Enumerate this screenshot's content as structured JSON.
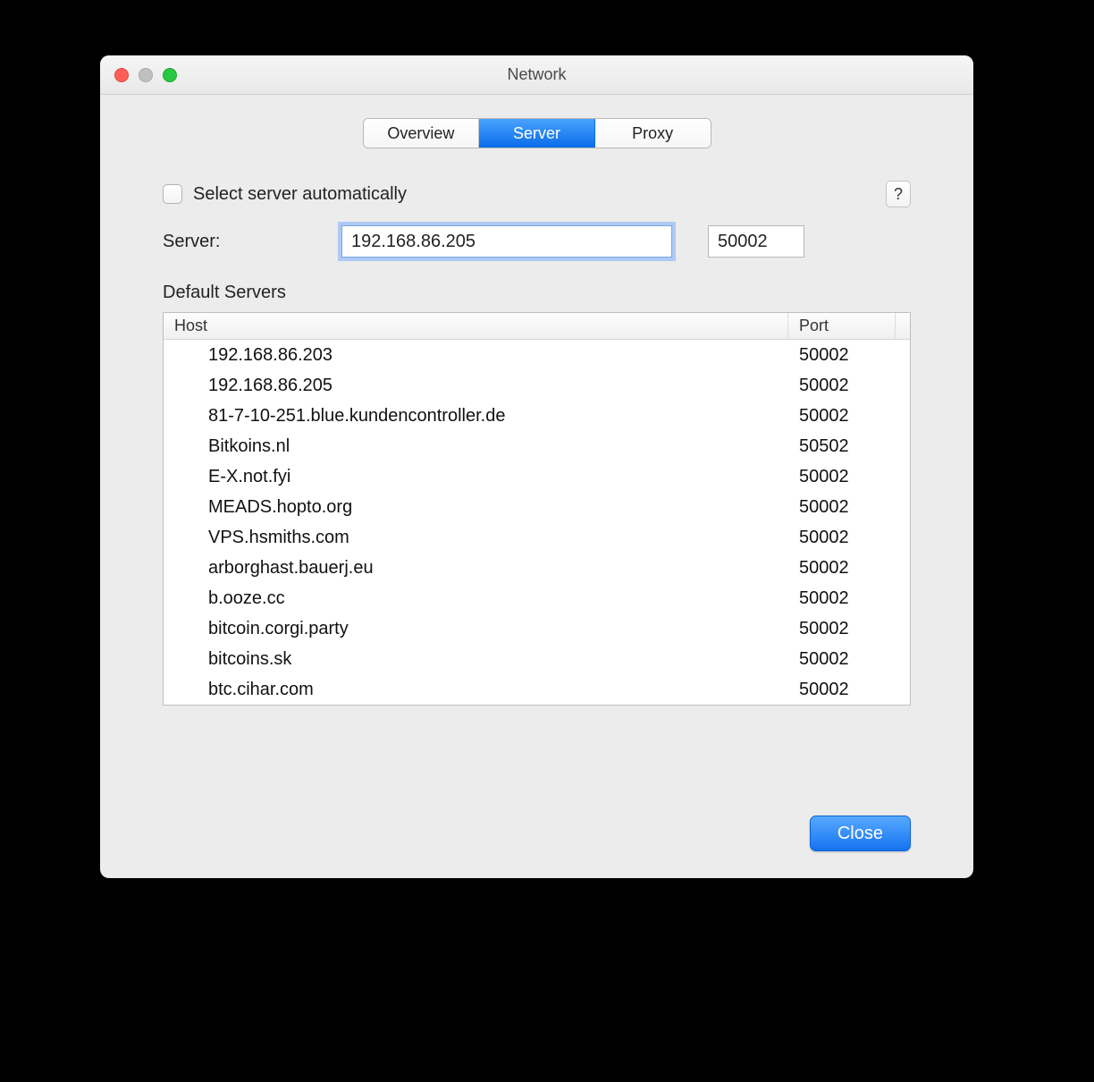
{
  "window": {
    "title": "Network"
  },
  "tabs": {
    "overview": "Overview",
    "server": "Server",
    "proxy": "Proxy",
    "active": "server"
  },
  "auto_select": {
    "checked": false,
    "label": "Select server automatically"
  },
  "help": {
    "label": "?"
  },
  "server_field": {
    "label": "Server:",
    "value": "192.168.86.205",
    "port": "50002"
  },
  "default_servers": {
    "label": "Default Servers",
    "columns": {
      "host": "Host",
      "port": "Port"
    },
    "rows": [
      {
        "host": "192.168.86.203",
        "port": "50002"
      },
      {
        "host": "192.168.86.205",
        "port": "50002"
      },
      {
        "host": "81-7-10-251.blue.kundencontroller.de",
        "port": "50002"
      },
      {
        "host": "Bitkoins.nl",
        "port": "50502"
      },
      {
        "host": "E-X.not.fyi",
        "port": "50002"
      },
      {
        "host": "MEADS.hopto.org",
        "port": "50002"
      },
      {
        "host": "VPS.hsmiths.com",
        "port": "50002"
      },
      {
        "host": "arborghast.bauerj.eu",
        "port": "50002"
      },
      {
        "host": "b.ooze.cc",
        "port": "50002"
      },
      {
        "host": "bitcoin.corgi.party",
        "port": "50002"
      },
      {
        "host": "bitcoins.sk",
        "port": "50002"
      },
      {
        "host": "btc.cihar.com",
        "port": "50002"
      }
    ]
  },
  "buttons": {
    "close": "Close"
  }
}
